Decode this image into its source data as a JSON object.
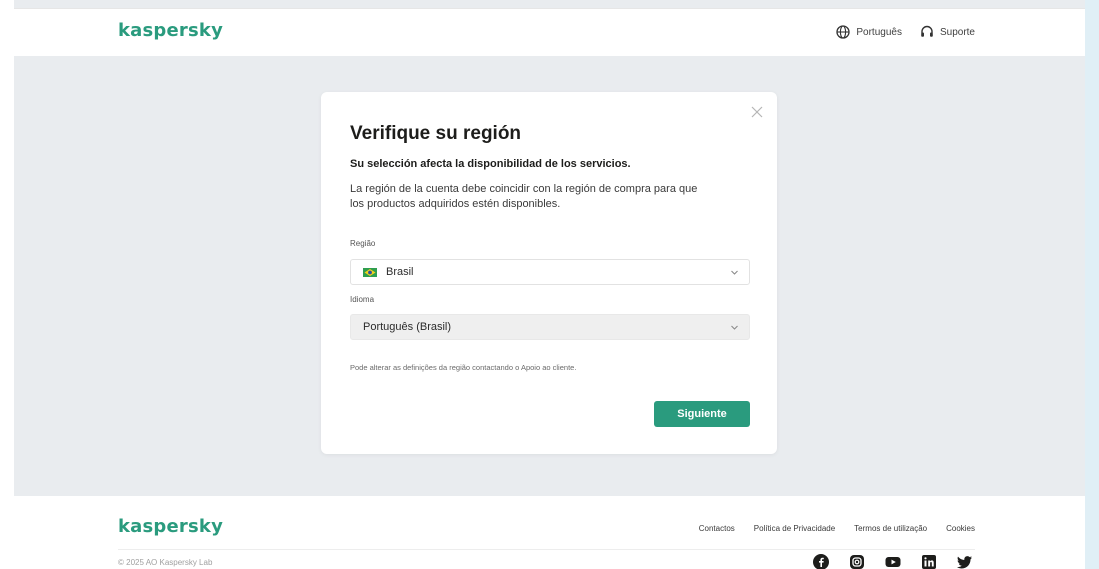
{
  "header": {
    "logo": "kaspersky",
    "language_link": "Português",
    "support_link": "Suporte"
  },
  "modal": {
    "title": "Verifique su región",
    "subtitle": "Su selección afecta la disponibilidad de los servicios.",
    "description": "La región de la cuenta debe coincidir con la región de compra para que los productos adquiridos estén disponibles.",
    "region_label": "Região",
    "region_value": "Brasil",
    "language_label": "Idioma",
    "language_value": "Português (Brasil)",
    "hint": "Pode alterar as definições da região contactando o Apoio ao cliente.",
    "next_button": "Siguiente"
  },
  "footer": {
    "logo": "kaspersky",
    "links": [
      "Contactos",
      "Política de Privacidade",
      "Termos de utilização",
      "Cookies"
    ],
    "copyright": "© 2025 AO Kaspersky Lab",
    "socials": [
      "facebook-icon",
      "instagram-icon",
      "youtube-icon",
      "linkedin-icon",
      "twitter-icon"
    ]
  },
  "colors": {
    "brand": "#2a9b7e",
    "background": "#e9ecef",
    "card": "#ffffff"
  }
}
